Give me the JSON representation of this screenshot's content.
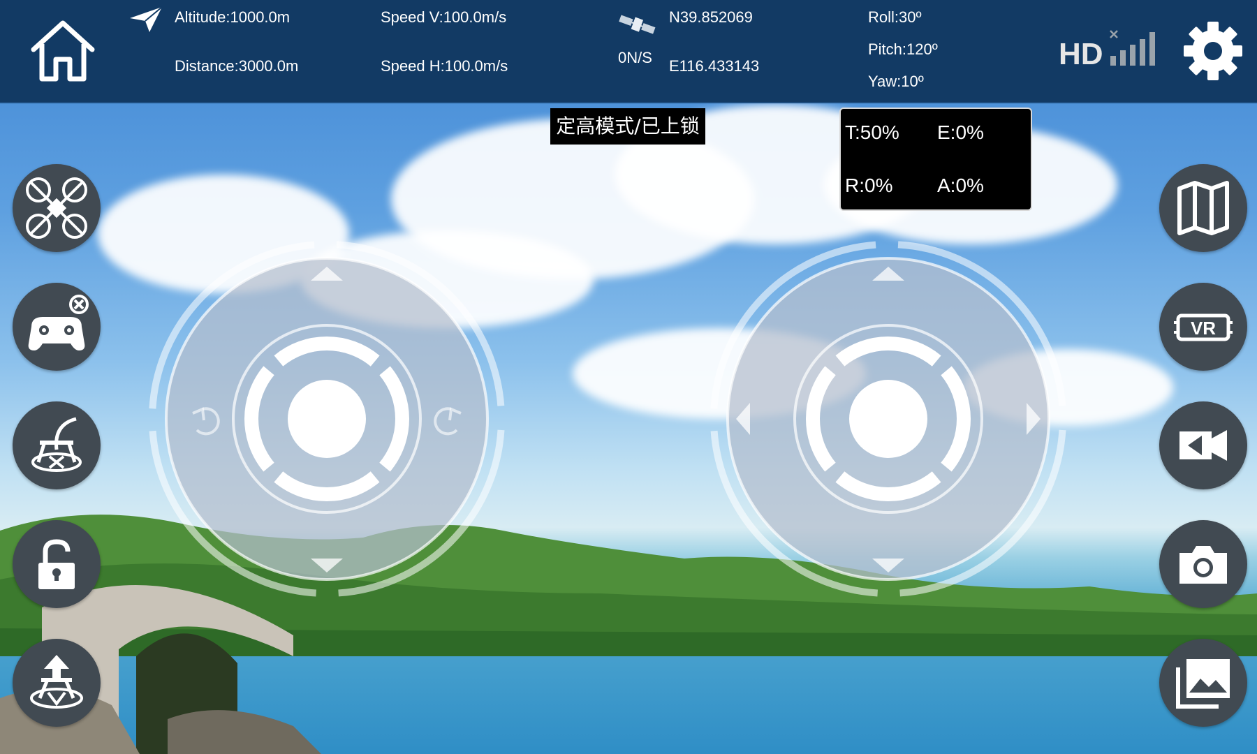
{
  "telemetry": {
    "altitude": "Altitude:1000.0m",
    "distance": "Distance:3000.0m",
    "speed_v": "Speed V:100.0m/s",
    "speed_h": "Speed H:100.0m/s",
    "satellites": "0N/S",
    "latitude": "N39.852069",
    "longitude": "E116.433143",
    "roll": "Roll:30º",
    "pitch": "Pitch:120º",
    "yaw": "Yaw:10º"
  },
  "mode_label": "定高模式/已上锁",
  "trim": {
    "t": "T:50%",
    "e": "E:0%",
    "r": "R:0%",
    "a": "A:0%"
  },
  "icons": {
    "home": "home-icon",
    "heading": "paper-plane-icon",
    "gps": "satellite-icon",
    "signal": "hd-signal-icon",
    "settings": "gear-icon",
    "left_buttons": [
      "drone-icon",
      "gamepad-icon",
      "headless-mode-icon",
      "lock-icon",
      "takeoff-landing-icon"
    ],
    "right_buttons": [
      "map-icon",
      "vr-icon",
      "video-record-icon",
      "camera-icon",
      "gallery-icon"
    ]
  },
  "colors": {
    "top_bar": "#123a64",
    "button_bg": "#414a52",
    "label_bg": "#000000"
  }
}
